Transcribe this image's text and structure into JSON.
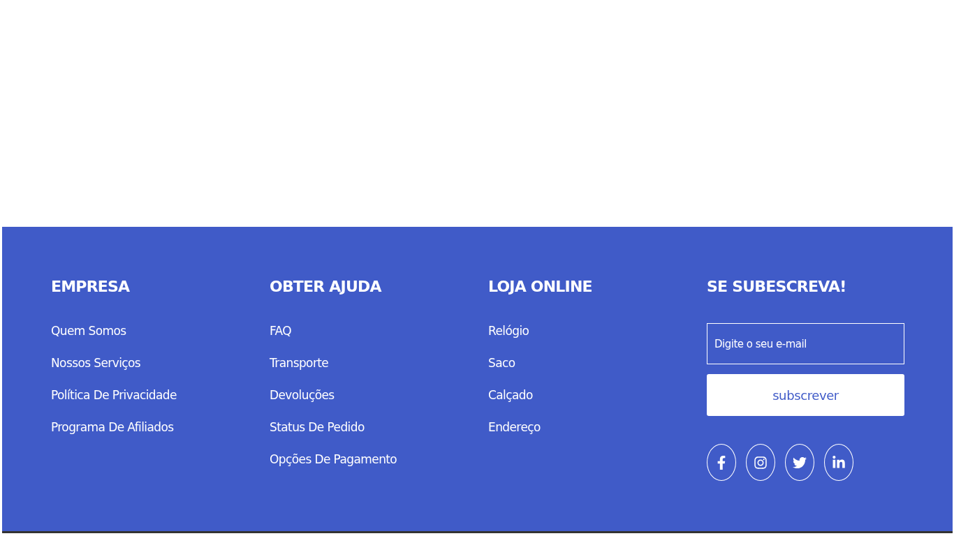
{
  "footer": {
    "columns": [
      {
        "heading": "EMPRESA",
        "links": [
          "Quem Somos",
          "Nossos Serviços",
          "Política De Privacidade",
          "Programa De Afiliados"
        ]
      },
      {
        "heading": "OBTER AJUDA",
        "links": [
          "FAQ",
          "Transporte",
          "Devoluções",
          "Status De Pedido",
          "Opções De Pagamento"
        ]
      },
      {
        "heading": "LOJA ONLINE",
        "links": [
          "Relógio",
          "Saco",
          "Calçado",
          "Endereço"
        ]
      }
    ],
    "subscribe": {
      "heading": "SE SUBESCREVA!",
      "placeholder": "Digite o seu e-mail",
      "button": "subscrever",
      "social": [
        {
          "kind": "facebook"
        },
        {
          "kind": "instagram"
        },
        {
          "kind": "twitter"
        },
        {
          "kind": "linkedin"
        }
      ]
    }
  }
}
